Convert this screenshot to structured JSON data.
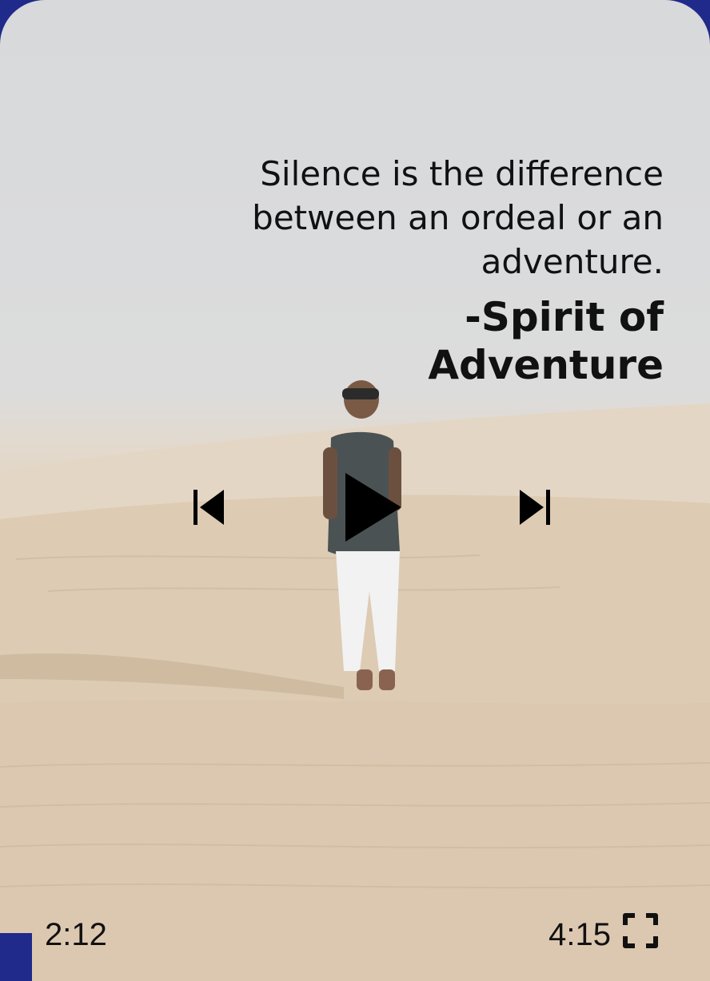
{
  "quote": {
    "text": "Silence is the difference between an ordeal or an adventure.",
    "author": "-Spirit of Adventure"
  },
  "player": {
    "current_time": "2:12",
    "total_time": "4:15",
    "icons": [
      "skip-previous-icon",
      "play-icon",
      "skip-next-icon",
      "fullscreen-icon"
    ]
  },
  "background": {
    "image": "desert-dunes-person-photo"
  },
  "colors": {
    "sky": "#d8dadc",
    "sand": "#dcc8ae",
    "accent_edge": "#1f2a8a",
    "text": "#111111"
  }
}
